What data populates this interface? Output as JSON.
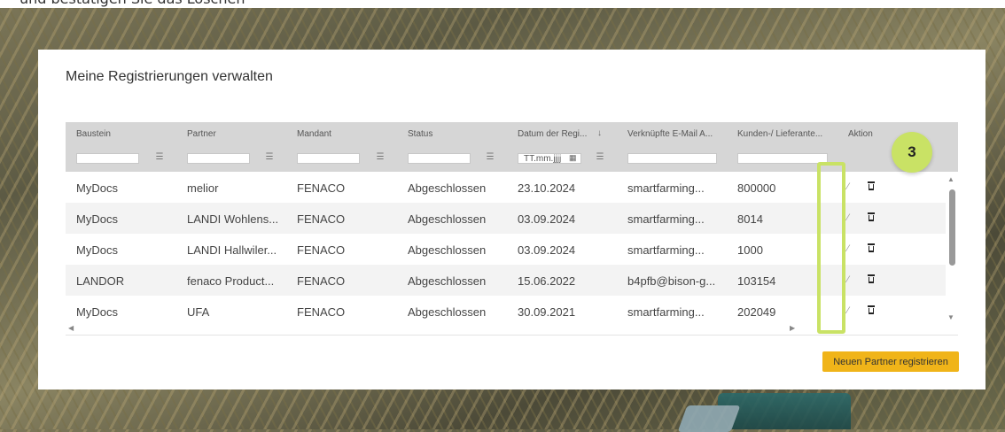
{
  "caption": "und bestätigen Sie das Löschen",
  "page_title": "Meine Registrierungen verwalten",
  "columns": [
    {
      "label": "Baustein"
    },
    {
      "label": "Partner"
    },
    {
      "label": "Mandant"
    },
    {
      "label": "Status"
    },
    {
      "label": "Datum der Regi..."
    },
    {
      "label": "Verknüpfte E-Mail A..."
    },
    {
      "label": "Kunden-/ Lieferante..."
    },
    {
      "label": "Aktion"
    }
  ],
  "date_filter_placeholder": "TT.mm.jjjj",
  "rows": [
    {
      "baustein": "MyDocs",
      "partner": "melior",
      "mandant": "FENACO",
      "status": "Abgeschlossen",
      "datum": "23.10.2024",
      "email": "smartfarming...",
      "kunde": "800000"
    },
    {
      "baustein": "MyDocs",
      "partner": "LANDI Wohlens...",
      "mandant": "FENACO",
      "status": "Abgeschlossen",
      "datum": "03.09.2024",
      "email": "smartfarming...",
      "kunde": "8014"
    },
    {
      "baustein": "MyDocs",
      "partner": "LANDI Hallwiler...",
      "mandant": "FENACO",
      "status": "Abgeschlossen",
      "datum": "03.09.2024",
      "email": "smartfarming...",
      "kunde": "1000"
    },
    {
      "baustein": "LANDOR",
      "partner": "fenaco Product...",
      "mandant": "FENACO",
      "status": "Abgeschlossen",
      "datum": "15.06.2022",
      "email": "b4pfb@bison-g...",
      "kunde": "103154"
    },
    {
      "baustein": "MyDocs",
      "partner": "UFA",
      "mandant": "FENACO",
      "status": "Abgeschlossen",
      "datum": "30.09.2021",
      "email": "smartfarming...",
      "kunde": "202049"
    }
  ],
  "step_badge": "3",
  "register_button": "Neuen Partner registrieren",
  "colors": {
    "accent_green": "#c9e265",
    "button_yellow": "#f0b419",
    "header_gray": "#d6d6d6"
  }
}
